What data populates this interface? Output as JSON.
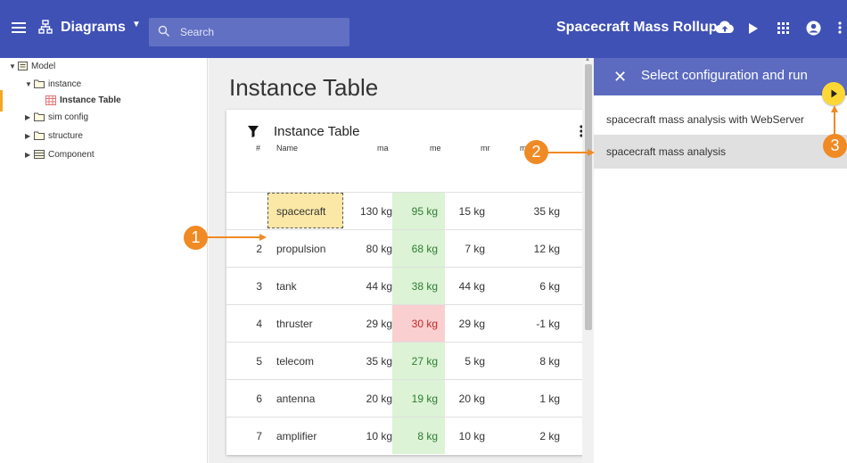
{
  "topbar": {
    "menu_icon": "hamburger-icon",
    "diagrams_label": "Diagrams",
    "search_placeholder": "Search",
    "app_title": "Spacecraft Mass Rollup",
    "icons": [
      "cloud-upload-icon",
      "play-icon",
      "apps-grid-icon",
      "account-icon",
      "more-vert-icon"
    ]
  },
  "tree": {
    "items": [
      {
        "label": "Model",
        "icon": "package-icon",
        "expanded": true
      },
      {
        "label": "instance",
        "icon": "folder-icon",
        "expanded": true
      },
      {
        "label": "Instance Table",
        "icon": "table-icon",
        "selected": true
      },
      {
        "label": "sim config",
        "icon": "folder-icon",
        "expanded": false
      },
      {
        "label": "structure",
        "icon": "folder-icon",
        "expanded": false
      },
      {
        "label": "Component",
        "icon": "component-icon",
        "expanded": false
      }
    ]
  },
  "main": {
    "page_title": "Instance Table",
    "card_title": "Instance Table",
    "columns": [
      "#",
      "Name",
      "ma",
      "me",
      "mr",
      "margin"
    ],
    "rows": [
      {
        "num": "",
        "name": "spacecraft",
        "ma": "130 kg",
        "me": "95 kg",
        "mr": "15 kg",
        "margin": "35 kg",
        "me_status": "green"
      },
      {
        "num": "2",
        "name": "propulsion",
        "ma": "80 kg",
        "me": "68 kg",
        "mr": "7 kg",
        "margin": "12 kg",
        "me_status": "green"
      },
      {
        "num": "3",
        "name": "tank",
        "ma": "44 kg",
        "me": "38 kg",
        "mr": "44 kg",
        "margin": "6 kg",
        "me_status": "green"
      },
      {
        "num": "4",
        "name": "thruster",
        "ma": "29 kg",
        "me": "30 kg",
        "mr": "29 kg",
        "margin": "-1 kg",
        "me_status": "red"
      },
      {
        "num": "5",
        "name": "telecom",
        "ma": "35 kg",
        "me": "27 kg",
        "mr": "5 kg",
        "margin": "8 kg",
        "me_status": "green"
      },
      {
        "num": "6",
        "name": "antenna",
        "ma": "20 kg",
        "me": "19 kg",
        "mr": "20 kg",
        "margin": "1 kg",
        "me_status": "green"
      },
      {
        "num": "7",
        "name": "amplifier",
        "ma": "10 kg",
        "me": "8 kg",
        "mr": "10 kg",
        "margin": "2 kg",
        "me_status": "green"
      }
    ]
  },
  "run_panel": {
    "title": "Select configuration and run",
    "options": [
      {
        "label": "spacecraft mass analysis with WebServer",
        "selected": false
      },
      {
        "label": "spacecraft mass analysis",
        "selected": true
      }
    ]
  },
  "callouts": [
    "1",
    "2",
    "3"
  ],
  "colors": {
    "primary": "#3f51b5",
    "panel_header": "#5c6bc0",
    "callout": "#f08a24",
    "ok": "#dcf3d5",
    "bad": "#f9cfcf",
    "selected_cell": "#fbe8a6",
    "fab": "#fdd835"
  }
}
